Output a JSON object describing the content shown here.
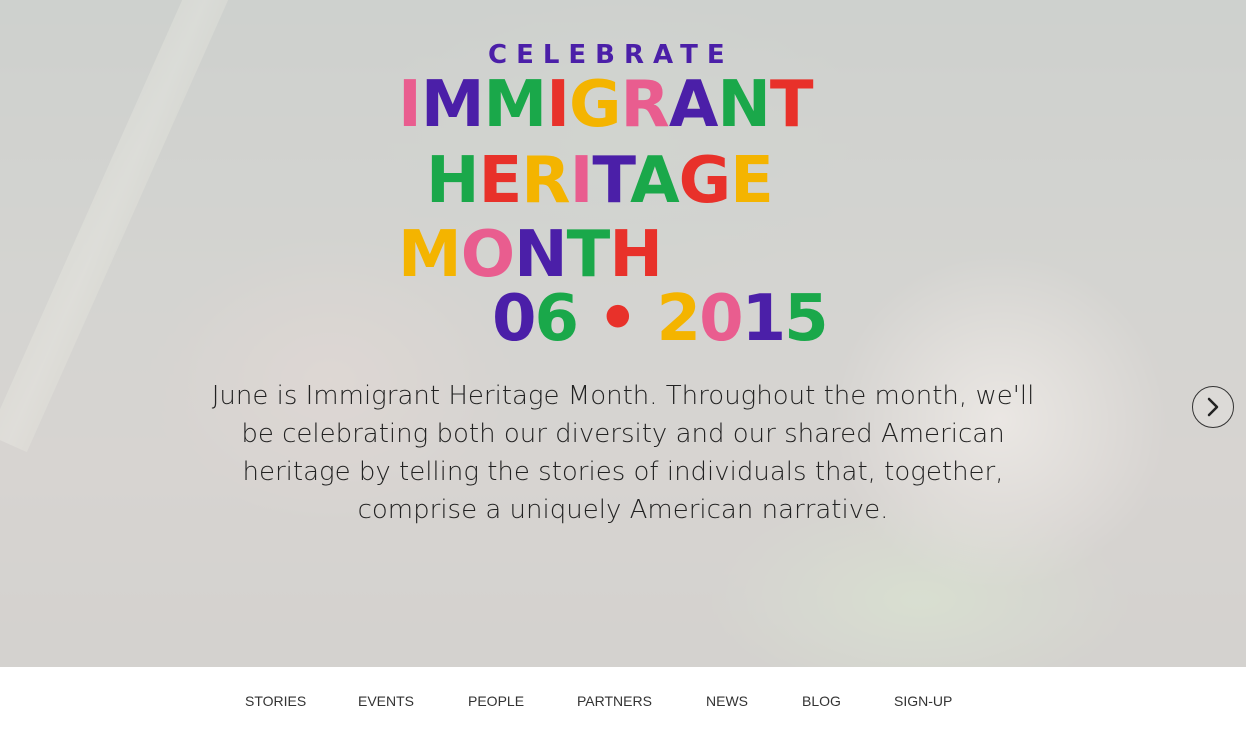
{
  "hero": {
    "logo": {
      "line1": "CELEBRATE",
      "line2": "IMMIGRANT",
      "line3": "HERITAGE",
      "line4": "MONTH",
      "line5": "06 • 2015"
    },
    "description": "June is Immigrant Heritage Month. Throughout the month, we'll be celebrating both our diversity and our shared American heritage by telling the stories of individuals that, together, comprise a uniquely American narrative.",
    "next_icon": "chevron-right-icon"
  },
  "nav": {
    "items": [
      "STORIES",
      "EVENTS",
      "PEOPLE",
      "PARTNERS",
      "NEWS",
      "BLOG",
      "SIGN-UP"
    ]
  },
  "colors": {
    "purple": "#4b1fa8",
    "pink": "#e95d8f",
    "red": "#e8312a",
    "green": "#1aa84a",
    "yellow": "#f4b400",
    "nav_text": "#333333"
  }
}
